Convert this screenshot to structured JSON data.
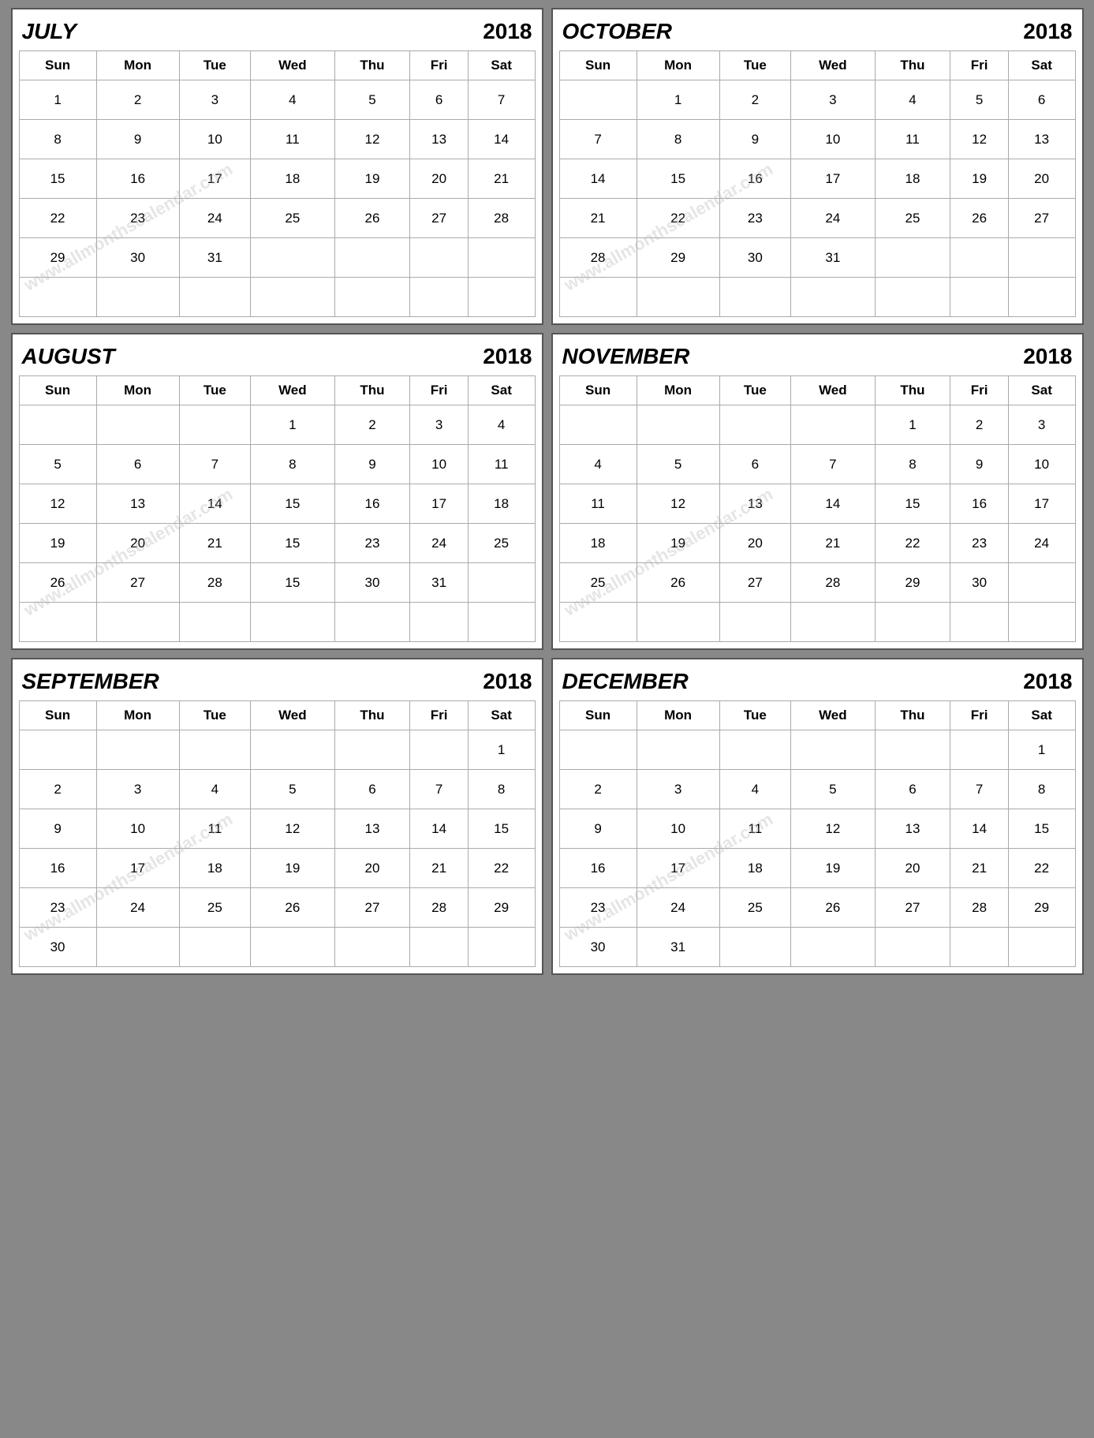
{
  "months": [
    {
      "name": "JULY",
      "year": "2018",
      "days": [
        "Sun",
        "Mon",
        "Tue",
        "Wed",
        "Thu",
        "Fri",
        "Sat"
      ],
      "weeks": [
        [
          "1",
          "2",
          "3",
          "4",
          "5",
          "6",
          "7"
        ],
        [
          "8",
          "9",
          "10",
          "11",
          "12",
          "13",
          "14"
        ],
        [
          "15",
          "16",
          "17",
          "18",
          "19",
          "20",
          "21"
        ],
        [
          "22",
          "23",
          "24",
          "25",
          "26",
          "27",
          "28"
        ],
        [
          "29",
          "30",
          "31",
          "",
          "",
          "",
          ""
        ],
        [
          "",
          "",
          "",
          "",
          "",
          "",
          ""
        ]
      ]
    },
    {
      "name": "OCTOBER",
      "year": "2018",
      "days": [
        "Sun",
        "Mon",
        "Tue",
        "Wed",
        "Thu",
        "Fri",
        "Sat"
      ],
      "weeks": [
        [
          "",
          "1",
          "2",
          "3",
          "4",
          "5",
          "6"
        ],
        [
          "7",
          "8",
          "9",
          "10",
          "11",
          "12",
          "13"
        ],
        [
          "14",
          "15",
          "16",
          "17",
          "18",
          "19",
          "20"
        ],
        [
          "21",
          "22",
          "23",
          "24",
          "25",
          "26",
          "27"
        ],
        [
          "28",
          "29",
          "30",
          "31",
          "",
          "",
          ""
        ],
        [
          "",
          "",
          "",
          "",
          "",
          "",
          ""
        ]
      ]
    },
    {
      "name": "AUGUST",
      "year": "2018",
      "days": [
        "Sun",
        "Mon",
        "Tue",
        "Wed",
        "Thu",
        "Fri",
        "Sat"
      ],
      "weeks": [
        [
          "",
          "",
          "",
          "1",
          "2",
          "3",
          "4"
        ],
        [
          "5",
          "6",
          "7",
          "8",
          "9",
          "10",
          "11"
        ],
        [
          "12",
          "13",
          "14",
          "15",
          "16",
          "17",
          "18"
        ],
        [
          "19",
          "20",
          "21",
          "15",
          "23",
          "24",
          "25"
        ],
        [
          "26",
          "27",
          "28",
          "15",
          "30",
          "31",
          ""
        ],
        [
          "",
          "",
          "",
          "",
          "",
          "",
          ""
        ]
      ]
    },
    {
      "name": "NOVEMBER",
      "year": "2018",
      "days": [
        "Sun",
        "Mon",
        "Tue",
        "Wed",
        "Thu",
        "Fri",
        "Sat"
      ],
      "weeks": [
        [
          "",
          "",
          "",
          "",
          "1",
          "2",
          "3"
        ],
        [
          "4",
          "5",
          "6",
          "7",
          "8",
          "9",
          "10"
        ],
        [
          "11",
          "12",
          "13",
          "14",
          "15",
          "16",
          "17"
        ],
        [
          "18",
          "19",
          "20",
          "21",
          "22",
          "23",
          "24"
        ],
        [
          "25",
          "26",
          "27",
          "28",
          "29",
          "30",
          ""
        ],
        [
          "",
          "",
          "",
          "",
          "",
          "",
          ""
        ]
      ]
    },
    {
      "name": "SEPTEMBER",
      "year": "2018",
      "days": [
        "Sun",
        "Mon",
        "Tue",
        "Wed",
        "Thu",
        "Fri",
        "Sat"
      ],
      "weeks": [
        [
          "",
          "",
          "",
          "",
          "",
          "",
          "1"
        ],
        [
          "2",
          "3",
          "4",
          "5",
          "6",
          "7",
          "8"
        ],
        [
          "9",
          "10",
          "11",
          "12",
          "13",
          "14",
          "15"
        ],
        [
          "16",
          "17",
          "18",
          "19",
          "20",
          "21",
          "22"
        ],
        [
          "23",
          "24",
          "25",
          "26",
          "27",
          "28",
          "29"
        ],
        [
          "30",
          "",
          "",
          "",
          "",
          "",
          ""
        ]
      ]
    },
    {
      "name": "DECEMBER",
      "year": "2018",
      "days": [
        "Sun",
        "Mon",
        "Tue",
        "Wed",
        "Thu",
        "Fri",
        "Sat"
      ],
      "weeks": [
        [
          "",
          "",
          "",
          "",
          "",
          "",
          "1"
        ],
        [
          "2",
          "3",
          "4",
          "5",
          "6",
          "7",
          "8"
        ],
        [
          "9",
          "10",
          "11",
          "12",
          "13",
          "14",
          "15"
        ],
        [
          "16",
          "17",
          "18",
          "19",
          "20",
          "21",
          "22"
        ],
        [
          "23",
          "24",
          "25",
          "26",
          "27",
          "28",
          "29"
        ],
        [
          "30",
          "31",
          "",
          "",
          "",
          "",
          ""
        ]
      ]
    }
  ]
}
